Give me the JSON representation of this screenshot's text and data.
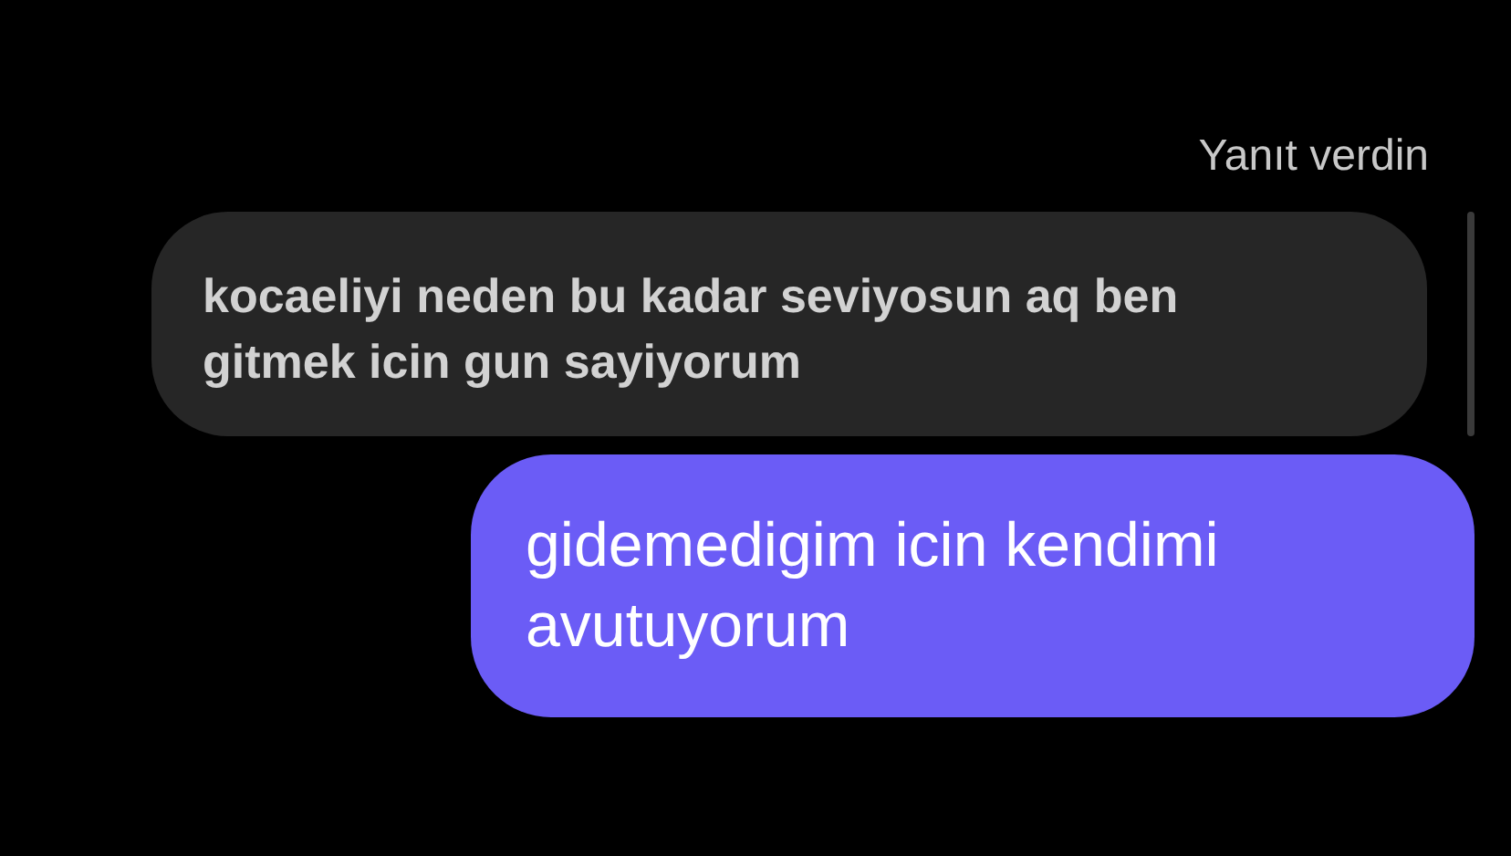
{
  "reply_label": "Yanıt verdin",
  "replied_message": {
    "text": "kocaeliyi neden bu kadar seviyosun aq ben gitmek icin gun sayiyorum"
  },
  "messages": [
    {
      "kind": "sent",
      "text": "gidemedigim icin kendimi avutuyorum"
    }
  ]
}
